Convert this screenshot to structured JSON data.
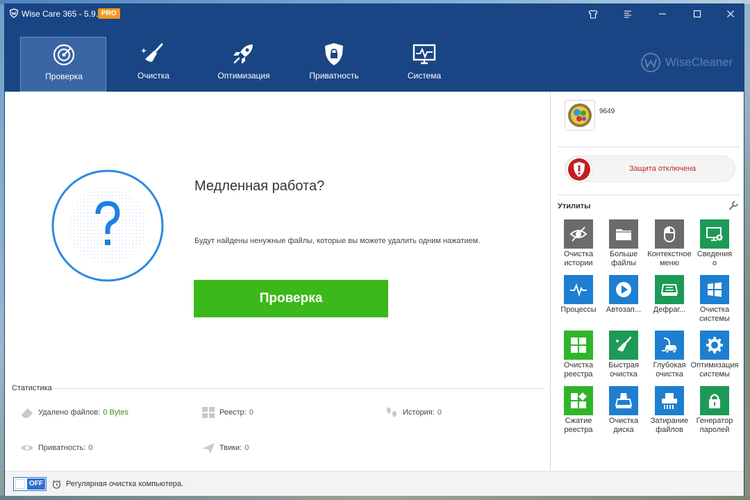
{
  "window": {
    "title": "Wise Care 365 - 5.9.2",
    "badge": "PRO"
  },
  "brand": "WiseCleaner",
  "nav": {
    "tabs": [
      {
        "label": "Проверка",
        "icon": "target-icon",
        "active": true
      },
      {
        "label": "Очистка",
        "icon": "broom-icon",
        "active": false
      },
      {
        "label": "Оптимизация",
        "icon": "rocket-icon",
        "active": false
      },
      {
        "label": "Приватность",
        "icon": "lock-shield-icon",
        "active": false
      },
      {
        "label": "Система",
        "icon": "monitor-pulse-icon",
        "active": false
      }
    ]
  },
  "main": {
    "headline": "Медленная работа?",
    "description": "Будут найдены ненужные файлы, которые вы можете удалить одним нажатием.",
    "scan_button": "Проверка"
  },
  "stats": {
    "title": "Статистика",
    "items": [
      {
        "label": "Удалено файлов:",
        "value": "0 Bytes"
      },
      {
        "label": "Реестр:",
        "value": "0"
      },
      {
        "label": "История:",
        "value": "0"
      },
      {
        "label": "Приватность:",
        "value": "0"
      },
      {
        "label": "Твики:",
        "value": "0"
      }
    ]
  },
  "sidebar": {
    "user_number": "9649",
    "protection": "Защита отключена",
    "utils_title": "Утилиты",
    "utils": [
      {
        "label": "Очистка\nистории",
        "color": "#6b6b6b",
        "icon": "eye-slash-icon"
      },
      {
        "label": "Больше\nфайлы",
        "color": "#6b6b6b",
        "icon": "folder-icon"
      },
      {
        "label": "Контекстное\nменю",
        "color": "#6b6b6b",
        "icon": "mouse-icon"
      },
      {
        "label": "Сведения\nо",
        "color": "#1d9a57",
        "icon": "monitor-gear-icon"
      },
      {
        "label": "Процессы",
        "color": "#1e7fd1",
        "icon": "pulse-icon"
      },
      {
        "label": "Автозап...",
        "color": "#1e7fd1",
        "icon": "play-icon"
      },
      {
        "label": "Дефраг...",
        "color": "#1d9a57",
        "icon": "drive-icon"
      },
      {
        "label": "Очистка\nсистемы",
        "color": "#1e7fd1",
        "icon": "windows-icon"
      },
      {
        "label": "Очистка\nреестра",
        "color": "#2fb52a",
        "icon": "grid-icon"
      },
      {
        "label": "Быстрая\nочистка",
        "color": "#1d9a57",
        "icon": "broom-icon"
      },
      {
        "label": "Глубокая\nочистка",
        "color": "#1e7fd1",
        "icon": "vacuum-icon"
      },
      {
        "label": "Оптимизация\nсистемы",
        "color": "#1e7fd1",
        "icon": "gear-icon"
      },
      {
        "label": "Сжатие\nреестра",
        "color": "#2fb52a",
        "icon": "blocks-icon"
      },
      {
        "label": "Очистка\nдиска",
        "color": "#1e7fd1",
        "icon": "disk-clean-icon"
      },
      {
        "label": "Затирание\nфайлов",
        "color": "#1e7fd1",
        "icon": "shredder-icon"
      },
      {
        "label": "Генератор\nпаролей",
        "color": "#1d9a57",
        "icon": "lock-icon"
      }
    ]
  },
  "footer": {
    "toggle": "OFF",
    "text": "Регулярная очистка компьютера."
  }
}
